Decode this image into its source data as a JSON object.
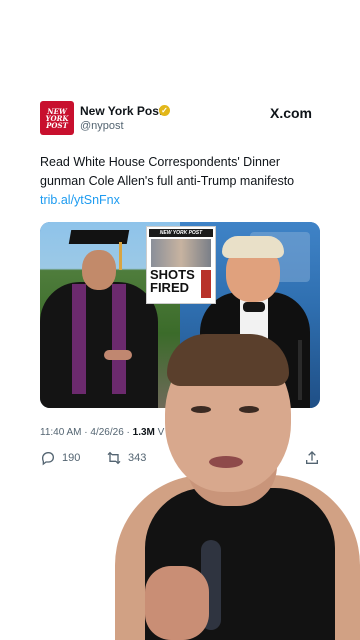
{
  "tweet": {
    "account": {
      "name": "New York Post",
      "handle": "@nypost",
      "logo_lines": [
        "NEW",
        "YORK",
        "POST"
      ],
      "logo_color": "#c8102e",
      "verified_color": "#e2b719"
    },
    "source": "X.com",
    "text": "Read White House Correspondents' Dinner gunman Cole Allen's full anti-Trump manifesto",
    "link": "trib.al/ytSnFnx",
    "link_color": "#1d9bf0",
    "media": {
      "newspaper_headline": "SHOTS FIRED"
    },
    "meta": {
      "timestamp": "11:40 AM · 4/26/26 ·",
      "views": "1.3M",
      "views_suffix": "V"
    },
    "actions": {
      "replies": "190",
      "retweets": "343"
    }
  }
}
